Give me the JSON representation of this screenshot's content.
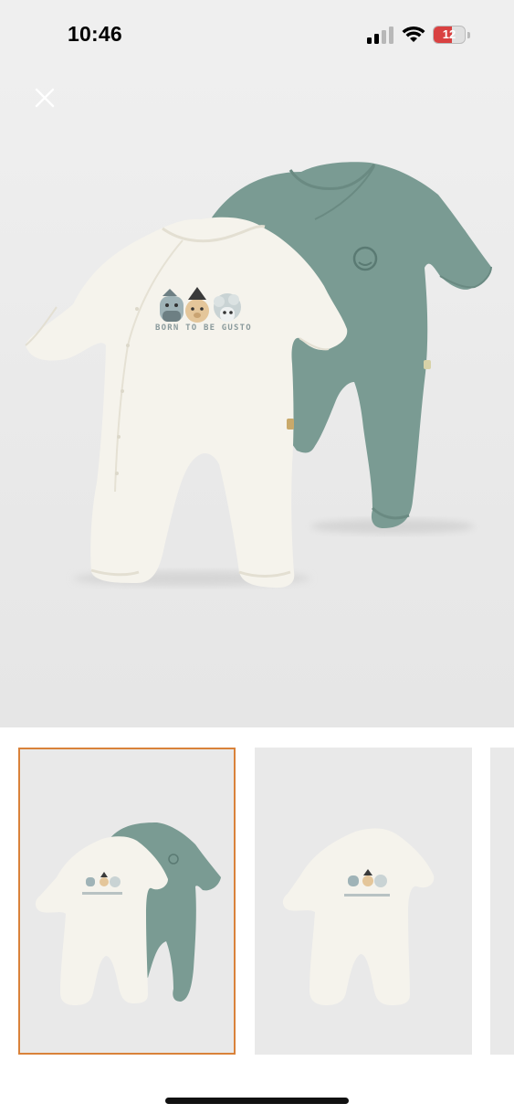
{
  "status_bar": {
    "time": "10:46",
    "battery_level": "12",
    "battery_fraction": 0.12,
    "icons": [
      "signal-icon",
      "wifi-icon",
      "battery-icon"
    ],
    "battery_color": "#d94141"
  },
  "hero": {
    "close_icon": "close-icon",
    "print_text": "BORN TO BE GUSTO",
    "background": "#ececec"
  },
  "thumbnails": {
    "selected_index": 0,
    "selected_border_color": "#d9823a",
    "items": [
      {
        "name": "thumbnail-two-pack"
      },
      {
        "name": "thumbnail-white-sleepsuit"
      },
      {
        "name": "thumbnail-next-partial"
      }
    ]
  },
  "colors": {
    "sleepsuit_white": "#f5f3ec",
    "sleepsuit_green": "#7a9b93"
  }
}
